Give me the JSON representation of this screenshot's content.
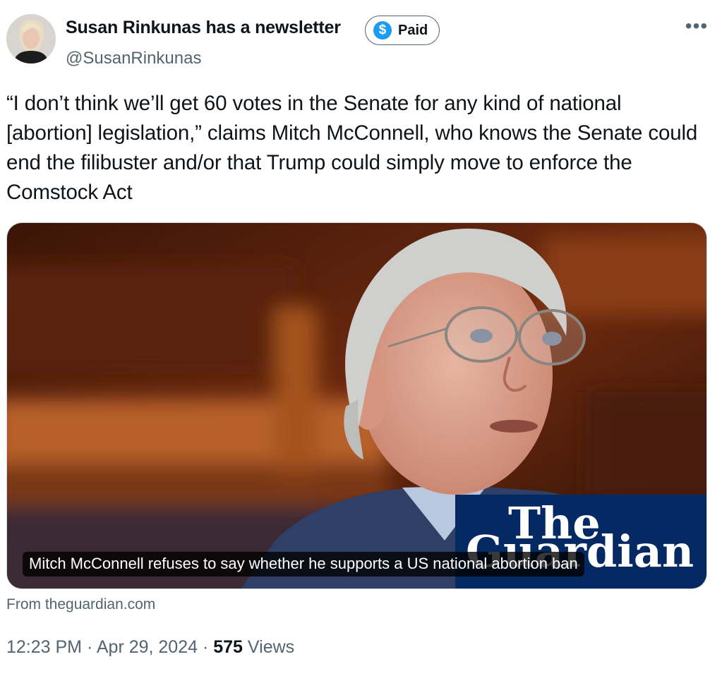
{
  "author": {
    "display_name": "Susan Rinkunas has a newsletter",
    "handle": "@SusanRinkunas",
    "badge_label": "Paid",
    "badge_symbol": "$"
  },
  "more_label": "•••",
  "tweet_text": "“I don’t think we’ll get 60 votes in the Senate for any kind of national [abortion] legislation,” claims Mitch McConnell, who knows the Senate could end the filibuster and/or that Trump could simply move to enforce the Comstock Act",
  "card": {
    "caption": "Mitch McConnell refuses to say whether he supports a US national abortion ban",
    "logo_line1": "The",
    "logo_line2": "Guardian",
    "source": "From theguardian.com"
  },
  "meta": {
    "time": "12:23 PM",
    "separator": " · ",
    "date": "Apr 29, 2024",
    "views_count": "575",
    "views_label": " Views"
  },
  "colors": {
    "accent": "#1d9bf0",
    "secondary_text": "#536471",
    "guardian_blue": "#052962"
  }
}
